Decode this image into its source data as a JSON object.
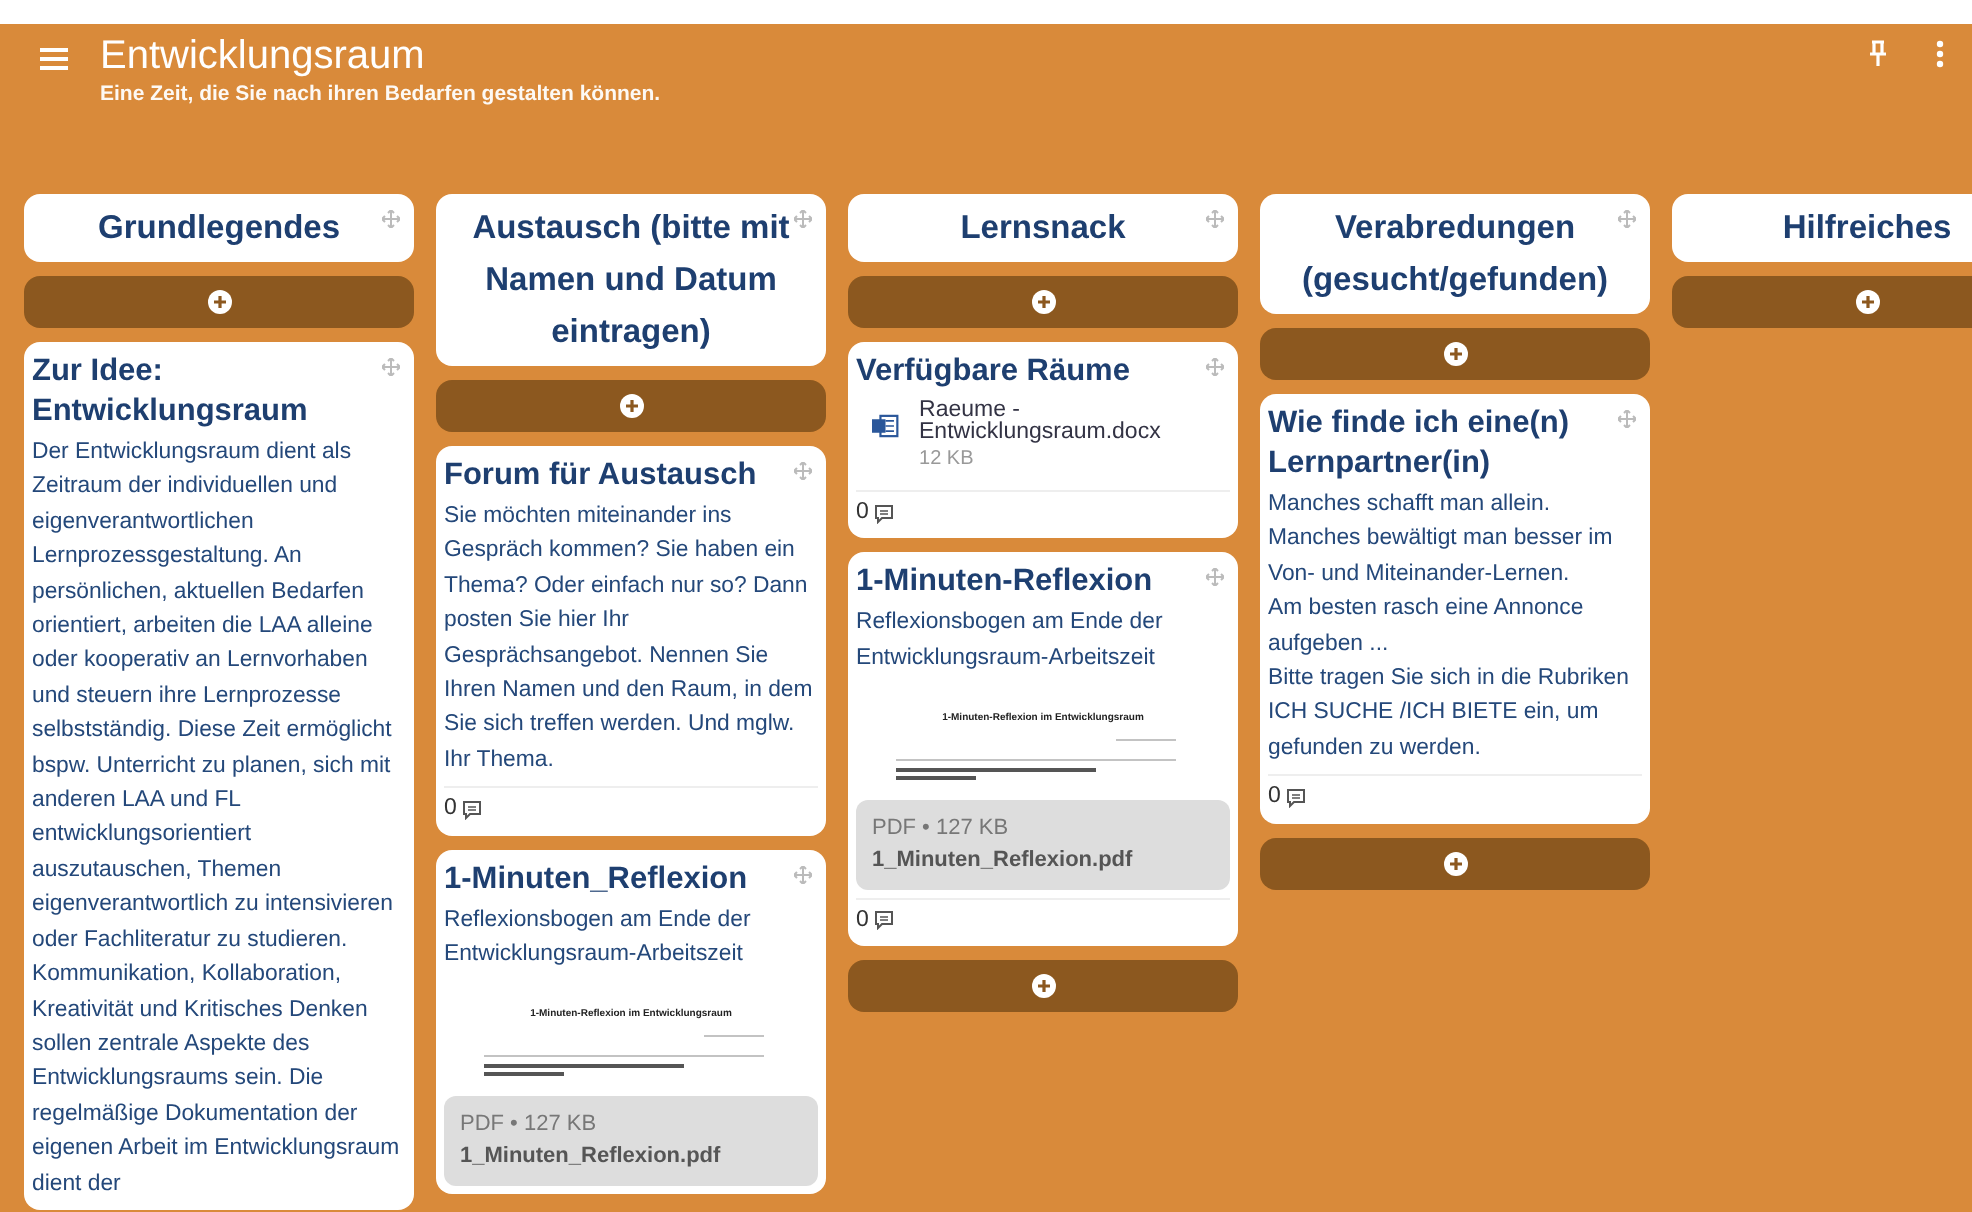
{
  "header": {
    "title": "Entwicklungsraum",
    "subtitle": "Eine Zeit, die Sie nach ihren Bedarfen gestalten können."
  },
  "columns": [
    {
      "title": "Grundlegendes",
      "items": [
        {
          "kind": "add"
        },
        {
          "kind": "post",
          "title": "Zur Idee: Entwicklungsraum",
          "body": [
            "Der Entwicklungsraum dient als Zeitraum der individuellen und eigenverantwortlichen Lernprozessgestaltung. An persönlichen, aktuellen Bedarfen orientiert, arbeiten die LAA alleine oder kooperativ an Lernvorhaben und steuern ihre Lernprozesse selbstständig. Diese Zeit ermöglicht bspw. Unterricht zu planen, sich mit anderen LAA und FL entwicklungsorientiert auszutauschen, Themen eigenverantwortlich zu intensivieren oder Fachliteratur zu studieren. Kommunikation, Kollaboration, Kreativität und Kritisches Denken sollen zentrale Aspekte des Entwicklungsraums sein. Die regelmäßige Dokumentation der eigenen Arbeit im Entwicklungsraum dient der"
          ]
        }
      ]
    },
    {
      "title": "Austausch (bitte mit Namen und Datum eintragen)",
      "items": [
        {
          "kind": "add"
        },
        {
          "kind": "post",
          "title": "Forum für Austausch",
          "body": [
            "Sie möchten miteinander ins Gespräch kommen? Sie haben ein Thema? Oder einfach nur so? Dann posten Sie hier Ihr Gesprächsangebot. Nennen Sie Ihren Namen und den Raum, in dem Sie sich treffen werden. Und mglw. Ihr Thema."
          ],
          "comments": "0"
        },
        {
          "kind": "post",
          "title": "1-Minuten_Reflexion",
          "body": [
            "Reflexionsbogen am Ende der Entwicklungsraum-Arbeitszeit"
          ],
          "attachment": {
            "kind": "pdf",
            "preview_heading": "1-Minuten-Reflexion im Entwicklungsraum",
            "meta": "PDF • 127 KB",
            "name": "1_Minuten_Reflexion.pdf"
          }
        }
      ]
    },
    {
      "title": "Lernsnack",
      "items": [
        {
          "kind": "add"
        },
        {
          "kind": "post",
          "title": "Verfügbare Räume",
          "attachment": {
            "kind": "docx",
            "name": "Raeume - Entwicklungsraum.docx",
            "meta": "12 KB"
          },
          "comments": "0"
        },
        {
          "kind": "post",
          "title": "1-Minuten-Reflexion",
          "body": [
            "Reflexionsbogen am Ende der Entwicklungsraum-Arbeitszeit"
          ],
          "attachment": {
            "kind": "pdf",
            "preview_heading": "1-Minuten-Reflexion im Entwicklungsraum",
            "meta": "PDF • 127 KB",
            "name": "1_Minuten_Reflexion.pdf"
          },
          "comments": "0"
        },
        {
          "kind": "add"
        }
      ]
    },
    {
      "title": "Verabredungen (gesucht/gefunden)",
      "items": [
        {
          "kind": "add"
        },
        {
          "kind": "post",
          "title": "Wie finde ich eine(n) Lernpartner(in)",
          "body": [
            "Manches schafft man allein.",
            "Manches bewältigt man besser im Von- und Miteinander-Lernen.",
            "Am besten rasch eine Annonce aufgeben ...",
            "Bitte tragen Sie sich in die Rubriken ICH SUCHE /ICH BIETE ein, um gefunden zu werden."
          ],
          "comments": "0"
        },
        {
          "kind": "add"
        }
      ]
    },
    {
      "title": "Hilfreiches",
      "items": [
        {
          "kind": "add"
        }
      ]
    }
  ]
}
